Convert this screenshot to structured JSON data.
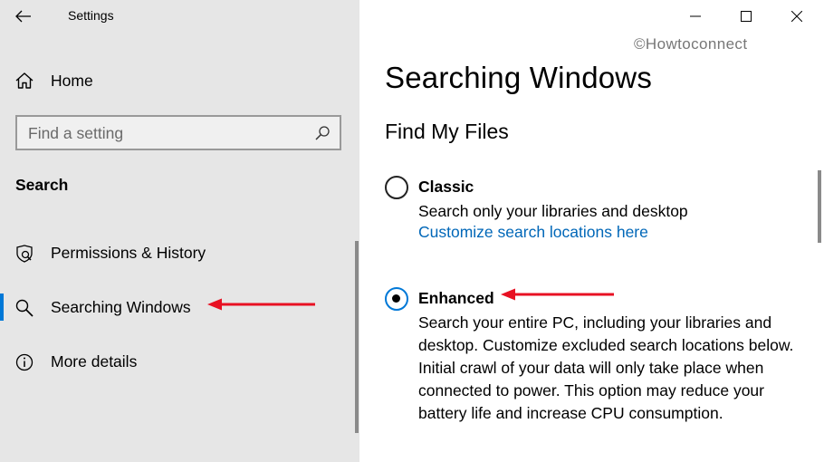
{
  "window": {
    "title": "Settings",
    "controls": {
      "minimize": "minimize",
      "maximize": "maximize",
      "close": "close"
    }
  },
  "sidebar": {
    "home_label": "Home",
    "search": {
      "placeholder": "Find a setting"
    },
    "section_heading": "Search",
    "items": [
      {
        "label": "Permissions & History",
        "icon": "shield-search-icon",
        "selected": false
      },
      {
        "label": "Searching Windows",
        "icon": "search-icon",
        "selected": true
      },
      {
        "label": "More details",
        "icon": "info-icon",
        "selected": false
      }
    ]
  },
  "main": {
    "watermark": "©Howtoconnect",
    "title": "Searching Windows",
    "subtitle": "Find My Files",
    "options": [
      {
        "label": "Classic",
        "description": "Search only your libraries and desktop",
        "link": "Customize search locations here",
        "checked": false
      },
      {
        "label": "Enhanced",
        "description": "Search your entire PC, including your libraries and desktop. Customize excluded search locations below. Initial crawl of your data will only take place when connected to power. This option may reduce your battery life and increase CPU consumption.",
        "checked": true
      }
    ]
  },
  "colors": {
    "accent": "#0078d7",
    "link": "#0067b8",
    "annotation_arrow": "#e81123",
    "sidebar_bg": "#e6e6e6"
  }
}
